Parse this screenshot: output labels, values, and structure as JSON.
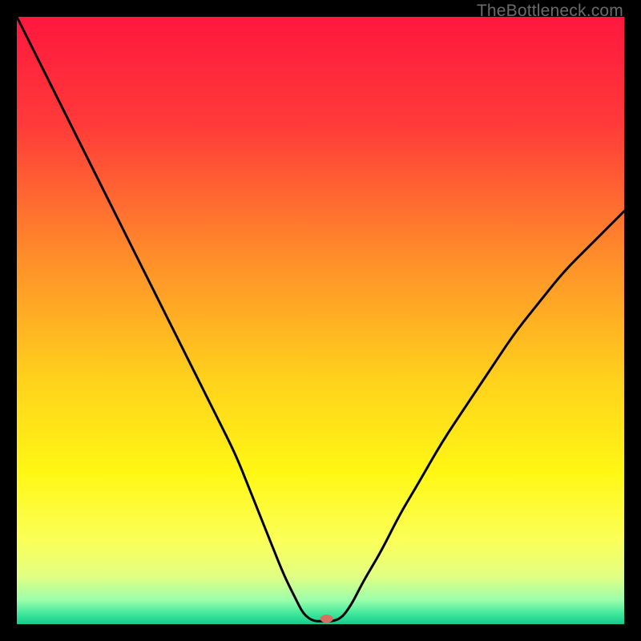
{
  "watermark": "TheBottleneck.com",
  "chart_data": {
    "type": "line",
    "title": "",
    "xlabel": "",
    "ylabel": "",
    "xlim": [
      0,
      100
    ],
    "ylim": [
      0,
      100
    ],
    "gradient_stops": [
      {
        "offset": 0.0,
        "color": "#ff173e"
      },
      {
        "offset": 0.18,
        "color": "#ff3b39"
      },
      {
        "offset": 0.4,
        "color": "#ff8f2a"
      },
      {
        "offset": 0.6,
        "color": "#ffd21c"
      },
      {
        "offset": 0.75,
        "color": "#fff714"
      },
      {
        "offset": 0.86,
        "color": "#fbff57"
      },
      {
        "offset": 0.92,
        "color": "#e3ff82"
      },
      {
        "offset": 0.96,
        "color": "#9cffab"
      },
      {
        "offset": 0.985,
        "color": "#38e59a"
      },
      {
        "offset": 1.0,
        "color": "#17c98d"
      }
    ],
    "series": [
      {
        "name": "bottleneck-curve",
        "x": [
          0,
          3,
          6,
          9,
          12,
          15,
          18,
          21,
          24,
          27,
          30,
          33,
          36,
          38,
          40,
          42,
          44,
          46,
          47,
          48,
          49,
          50,
          53,
          55,
          57,
          60,
          63,
          66,
          70,
          74,
          78,
          82,
          86,
          90,
          94,
          98,
          100
        ],
        "y": [
          100,
          94,
          88,
          82,
          76,
          70,
          64,
          58,
          52,
          46,
          40,
          34,
          28,
          23,
          18,
          13,
          8,
          4,
          2,
          1,
          0.5,
          0.5,
          0.5,
          3,
          7,
          12,
          18,
          23,
          30,
          36,
          42,
          48,
          53,
          58,
          62,
          66,
          68
        ]
      }
    ],
    "flat_region": {
      "x_start": 47,
      "x_end": 53,
      "y": 0.5
    },
    "marker": {
      "x": 51,
      "y": 0.9,
      "color": "#d86f63",
      "rx": 8,
      "ry": 5
    }
  }
}
